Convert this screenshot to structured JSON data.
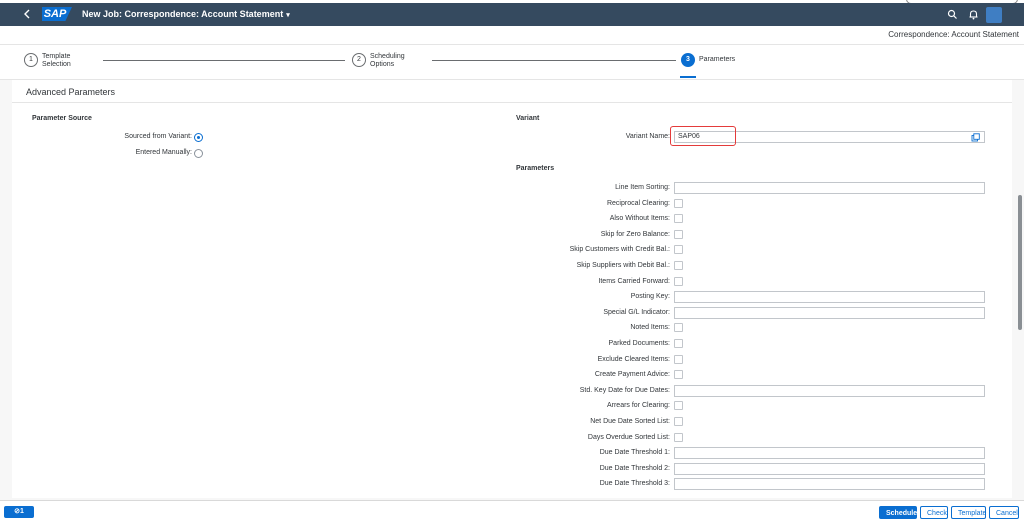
{
  "shell": {
    "title": "New Job: Correspondence: Account Statement",
    "logo": "SAP",
    "title_caret": "▾"
  },
  "subheader": {
    "title": "Correspondence: Account Statement"
  },
  "wizard": {
    "steps": [
      {
        "number": "1",
        "label": "Template Selection",
        "active": false
      },
      {
        "number": "2",
        "label": "Scheduling Options",
        "active": false
      },
      {
        "number": "3",
        "label": "Parameters",
        "active": true
      }
    ]
  },
  "section": {
    "title": "Advanced Parameters"
  },
  "parameter_source": {
    "title": "Parameter Source",
    "options": [
      {
        "label": "Sourced from Variant:",
        "checked": true
      },
      {
        "label": "Entered Manually:",
        "checked": false
      }
    ]
  },
  "variant": {
    "title": "Variant",
    "name_label": "Variant Name:",
    "name_value": "SAP06"
  },
  "parameters": {
    "title": "Parameters",
    "fields": [
      {
        "label": "Line Item Sorting:",
        "type": "input"
      },
      {
        "label": "Reciprocal Clearing:",
        "type": "checkbox"
      },
      {
        "label": "Also Without Items:",
        "type": "checkbox"
      },
      {
        "label": "Skip for Zero Balance:",
        "type": "checkbox"
      },
      {
        "label": "Skip Customers with Credit Bal.:",
        "type": "checkbox"
      },
      {
        "label": "Skip Suppliers with Debit Bal.:",
        "type": "checkbox"
      },
      {
        "label": "Items Carried Forward:",
        "type": "checkbox"
      },
      {
        "label": "Posting Key:",
        "type": "input"
      },
      {
        "label": "Special G/L Indicator:",
        "type": "input"
      },
      {
        "label": "Noted Items:",
        "type": "checkbox"
      },
      {
        "label": "Parked Documents:",
        "type": "checkbox"
      },
      {
        "label": "Exclude Cleared Items:",
        "type": "checkbox"
      },
      {
        "label": "Create Payment Advice:",
        "type": "checkbox"
      },
      {
        "label": "Std. Key Date for Due Dates:",
        "type": "input"
      },
      {
        "label": "Arrears for Clearing:",
        "type": "checkbox"
      },
      {
        "label": "Net Due Date Sorted List:",
        "type": "checkbox"
      },
      {
        "label": "Days Overdue Sorted List:",
        "type": "checkbox"
      },
      {
        "label": "Due Date Threshold 1:",
        "type": "input"
      },
      {
        "label": "Due Date Threshold 2:",
        "type": "input"
      },
      {
        "label": "Due Date Threshold 3:",
        "type": "input"
      }
    ]
  },
  "footer": {
    "message_count": "⊘1",
    "buttons": {
      "schedule": "Schedule",
      "check": "Check",
      "template": "Template",
      "cancel": "Cancel"
    }
  },
  "colors": {
    "shell": "#354a5f",
    "accent": "#0a6ed1",
    "highlight": "#e43b3b"
  },
  "icons": {
    "back": "chevron-left-icon",
    "search": "search-icon",
    "notifications": "bell-icon",
    "value_help": "value-help-icon"
  }
}
